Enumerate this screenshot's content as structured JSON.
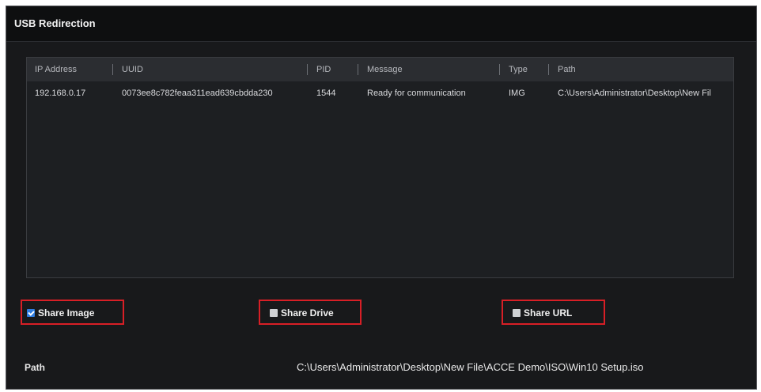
{
  "window": {
    "title": "USB Redirection"
  },
  "table": {
    "columns": [
      "IP Address",
      "UUID",
      "PID",
      "Message",
      "Type",
      "Path"
    ],
    "rows": [
      [
        "192.168.0.17",
        "0073ee8c782feaa311ead639cbdda230",
        "1544",
        "Ready for communication",
        "IMG",
        "C:\\Users\\Administrator\\Desktop\\New Fil"
      ]
    ]
  },
  "options": {
    "share_image": {
      "label": "Share Image",
      "checked": true
    },
    "share_drive": {
      "label": "Share Drive",
      "checked": false
    },
    "share_url": {
      "label": "Share URL",
      "checked": false
    }
  },
  "path": {
    "label": "Path",
    "value": "C:\\Users\\Administrator\\Desktop\\New File\\ACCE Demo\\ISO\\Win10 Setup.iso"
  },
  "colors": {
    "highlight_border": "#d81f26",
    "checkbox_checked": "#2f7de1",
    "background": "#18191b"
  }
}
